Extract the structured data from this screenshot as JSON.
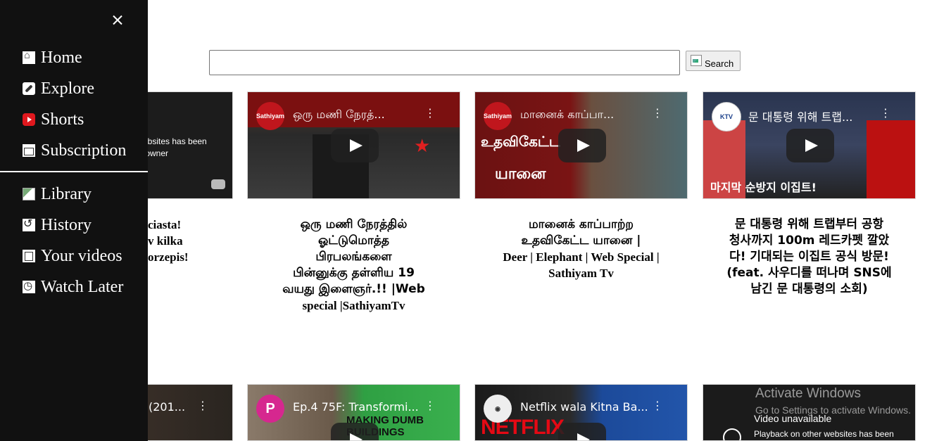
{
  "search": {
    "placeholder": "",
    "value": "",
    "button_label": "Search"
  },
  "sidebar": {
    "close_icon": "close-icon",
    "items": [
      {
        "label": "Home",
        "icon": "home-icon"
      },
      {
        "label": "Explore",
        "icon": "explore-icon"
      },
      {
        "label": "Shorts",
        "icon": "shorts-icon"
      },
      {
        "label": "Subscription",
        "icon": "subscription-icon"
      },
      {
        "label": "Library",
        "icon": "library-icon"
      },
      {
        "label": "History",
        "icon": "history-icon"
      },
      {
        "label": "Your videos",
        "icon": "your-videos-icon"
      },
      {
        "label": "Watch Later",
        "icon": "watch-later-icon"
      }
    ]
  },
  "row1": [
    {
      "thumb_text": "ebsites has been\n owner",
      "caption": "ciasta!\nv kilka\norzepis!"
    },
    {
      "channel": "Sathiyam",
      "thumb_title": "ஒரு மணி நேரத்...",
      "caption_l1": "ஒரு மணி நேரத்தில்",
      "caption_l2": "ஓட்டுமொத்த",
      "caption_l3": "பிரபலங்களை",
      "caption_l4": "பின்னுக்கு தள்ளிய 19",
      "caption_l5": "வயது இளைஞர்.!! |Web",
      "caption_l6": "special |SathiyamTv"
    },
    {
      "channel": "Sathiyam",
      "thumb_title": "மானைக் காப்பா...",
      "caption_l1": "மானைக் காப்பாற்ற",
      "caption_l2": "உதவிகேட்ட யானை |",
      "caption_l3": "Deer | Elephant | Web Special |",
      "caption_l4": "Sathiyam Tv"
    },
    {
      "channel": "KTV",
      "thumb_title": "문 대통령 위해 트랩...",
      "caption_l1": "문 대통령 위해 트랩부터 공항",
      "caption_l2": "청사까지 100m 레드카펫 깔았",
      "caption_l3": "다! 기대되는 이집트 공식 방문!",
      "caption_l4": "(feat. 사우디를 떠나며 SNS에",
      "caption_l5": "남긴 문 대통령의 소회)"
    }
  ],
  "row2": [
    {
      "thumb_title": "(201..."
    },
    {
      "thumb_title": "Ep.4 75F: Transformi...",
      "overlay": "MAKING DUMB\nBUILDINGS"
    },
    {
      "thumb_title": "Netflix wala Kitna Ba...",
      "overlay": "NETFLIX"
    },
    {
      "unavailable_title": "Video unavailable",
      "unavailable_sub": "Playback on other websites has been"
    }
  ],
  "activate": {
    "title": "Activate Windows",
    "subtitle": "Go to Settings to activate Windows."
  }
}
